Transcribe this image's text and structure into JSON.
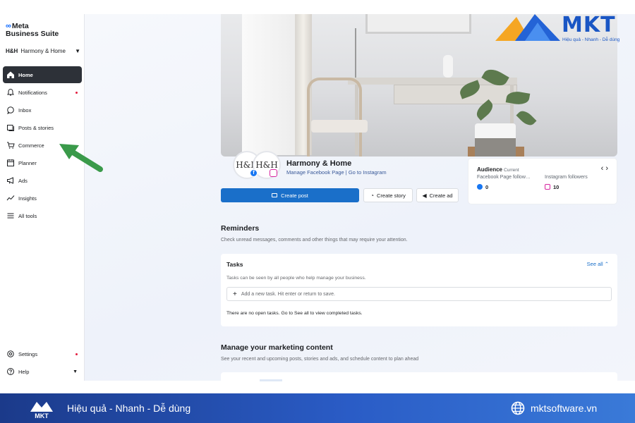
{
  "brand": {
    "line1": "Meta",
    "line2": "Business Suite"
  },
  "account": {
    "initials": "H&H",
    "name": "Harmony & Home"
  },
  "nav": [
    {
      "label": "Home",
      "icon": "home-icon",
      "active": true
    },
    {
      "label": "Notifications",
      "icon": "bell-icon",
      "dot": true
    },
    {
      "label": "Inbox",
      "icon": "chat-bubble-icon"
    },
    {
      "label": "Posts & stories",
      "icon": "posts-icon"
    },
    {
      "label": "Commerce",
      "icon": "cart-icon"
    },
    {
      "label": "Planner",
      "icon": "calendar-icon"
    },
    {
      "label": "Ads",
      "icon": "megaphone-icon"
    },
    {
      "label": "Insights",
      "icon": "chart-icon"
    },
    {
      "label": "All tools",
      "icon": "menu-icon"
    }
  ],
  "nav_bottom": [
    {
      "label": "Settings",
      "icon": "gear-icon",
      "dot": true
    },
    {
      "label": "Help",
      "icon": "help-icon"
    }
  ],
  "mkt": {
    "name": "MKT",
    "tagline": "Hiệu quả - Nhanh - Dễ dùng"
  },
  "profile": {
    "avatar_text": "H&H",
    "page_name": "Harmony & Home",
    "links": "Manage Facebook Page | Go to Instagram"
  },
  "actions": {
    "create_post": "Create post",
    "create_story": "Create story",
    "create_ad": "Create ad"
  },
  "audience": {
    "title": "Audience",
    "subtitle": "Current",
    "nav": "‹ ›",
    "fb_label": "Facebook Page follow…",
    "fb_value": "0",
    "ig_label": "Instagram followers",
    "ig_value": "10"
  },
  "reminders": {
    "title": "Reminders",
    "desc": "Check unread messages, comments and other things that may require your attention."
  },
  "tasks": {
    "title": "Tasks",
    "see_all": "See all",
    "desc": "Tasks can be seen by all people who help manage your business.",
    "input_placeholder": "Add a new task. Hit enter or return to save.",
    "empty": "There are no open tasks. Go to See all to view completed tasks."
  },
  "marketing": {
    "title": "Manage your marketing content",
    "desc": "See your recent and upcoming posts, stories and ads, and schedule content to plan ahead"
  },
  "footer": {
    "logo_text": "MKT",
    "tagline": "Hiệu quả - Nhanh - Dễ dùng",
    "site": "mktsoftware.vn"
  },
  "colors": {
    "primary": "#1a6fc9",
    "active_nav": "#2d3138",
    "arrow": "#3a9a4a",
    "footer": "#2a5cc6"
  }
}
